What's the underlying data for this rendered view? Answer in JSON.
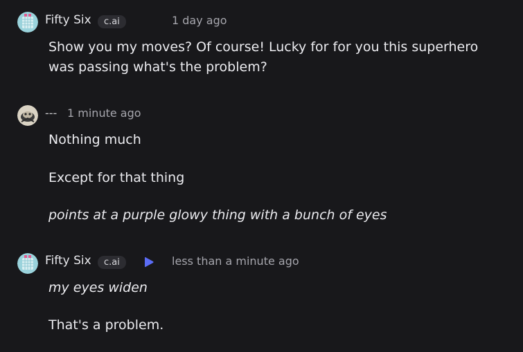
{
  "messages": [
    {
      "author": "Fifty Six",
      "badge": "c.ai",
      "time": "1 day ago",
      "avatar_icon": "grid-character-avatar",
      "lines": [
        "Show you my moves? Of course! Lucky for for you this superhero was passing what's the problem?"
      ]
    },
    {
      "author": "---",
      "time": "1 minute ago",
      "avatar_icon": "user-photo-avatar",
      "lines": [
        "Nothing much",
        "Except for that thing",
        "points at a purple glowy thing with a bunch of eyes"
      ]
    },
    {
      "author": "Fifty Six",
      "badge": "c.ai",
      "time": "less than a minute ago",
      "avatar_icon": "grid-character-avatar",
      "play_icon": "play-icon",
      "lines": [
        "my eyes widen",
        "That's a problem."
      ]
    }
  ],
  "colors": {
    "background": "#18181b",
    "badge_bg": "#2c2c31",
    "play_accent": "#5b6cf5",
    "avatar_bg": "#9ad3dc"
  }
}
